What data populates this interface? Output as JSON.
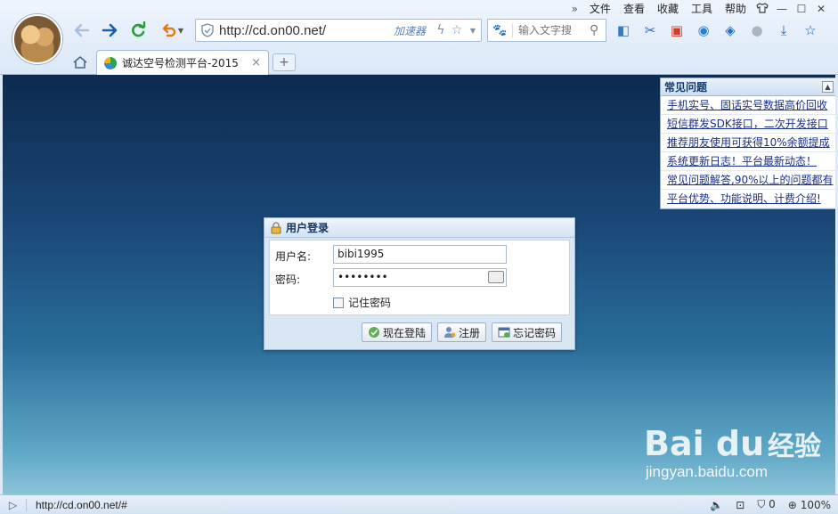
{
  "menu": {
    "more": "»",
    "items": [
      "文件",
      "查看",
      "收藏",
      "工具",
      "帮助"
    ]
  },
  "address": {
    "url": "http://cd.on00.net/",
    "accelerator": "加速器"
  },
  "search": {
    "placeholder": "输入文字搜"
  },
  "tab": {
    "title": "诚达空号检测平台-2015",
    "close": "×",
    "new": "+"
  },
  "faq": {
    "title": "常见问题",
    "items": [
      "手机实号、固话实号数据高价回收",
      "短信群发SDK接口，二次开发接口",
      "推荐朋友使用可获得10%余额提成",
      "系统更新日志！平台最新动态！",
      "常见问题解答,90%以上的问题都有",
      "平台优势、功能说明、计费介绍!"
    ]
  },
  "login": {
    "title": "用户登录",
    "username_label": "用户名:",
    "username_value": "bibi1995",
    "password_label": "密码:",
    "password_value": "••••••••",
    "remember_label": "记住密码",
    "buttons": {
      "login": "现在登陆",
      "register": "注册",
      "forgot": "忘记密码"
    }
  },
  "watermark": {
    "brand": "Bai du",
    "cn": "经验",
    "url": "jingyan.baidu.com"
  },
  "status": {
    "url": "http://cd.on00.net/#",
    "adblock_count": "0",
    "zoom": "100%"
  }
}
